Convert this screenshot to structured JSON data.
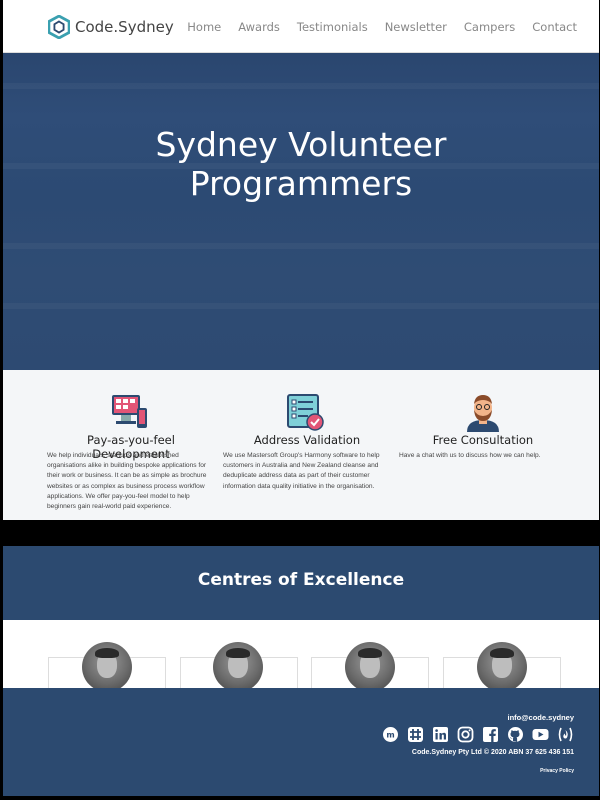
{
  "header": {
    "brand": "Code.Sydney",
    "nav": [
      "Home",
      "Awards",
      "Testimonials",
      "Newsletter",
      "Campers",
      "Contact"
    ]
  },
  "hero": {
    "line1": "Sydney Volunteer",
    "line2": "Programmers"
  },
  "services": [
    {
      "icon": "computer-devices-icon",
      "title": "Pay-as-you-feel Development",
      "text": "We help individuals, startups and established organisations alike in building bespoke applications for their work or business. It can be as simple as brochure websites or as complex as business process workflow applications. We offer pay-you-feel model to help beginners gain real-world paid experience."
    },
    {
      "icon": "checklist-icon",
      "title": "Address Validation",
      "text": "We use Mastersoft Group's Harmony software to help customers in Australia and New Zealand cleanse and deduplicate address data as part of their customer information data quality initiative in the organisation."
    },
    {
      "icon": "person-icon",
      "title": "Free Consultation",
      "text": "Have a chat with us to discuss how we can help."
    }
  ],
  "centres": {
    "title": "Centres of Excellence"
  },
  "footer": {
    "email": "info@code.sydney",
    "social": [
      "meetup-icon",
      "slack-icon",
      "linkedin-icon",
      "instagram-icon",
      "facebook-icon",
      "github-icon",
      "youtube-icon",
      "freecodecamp-icon"
    ],
    "copyright": "Code.Sydney Pty Ltd © 2020 ABN 37 625 436 151",
    "privacy": "Privacy Policy"
  },
  "colors": {
    "brand_blue": "#2c4a70",
    "accent_teal": "#3aa0b0"
  }
}
